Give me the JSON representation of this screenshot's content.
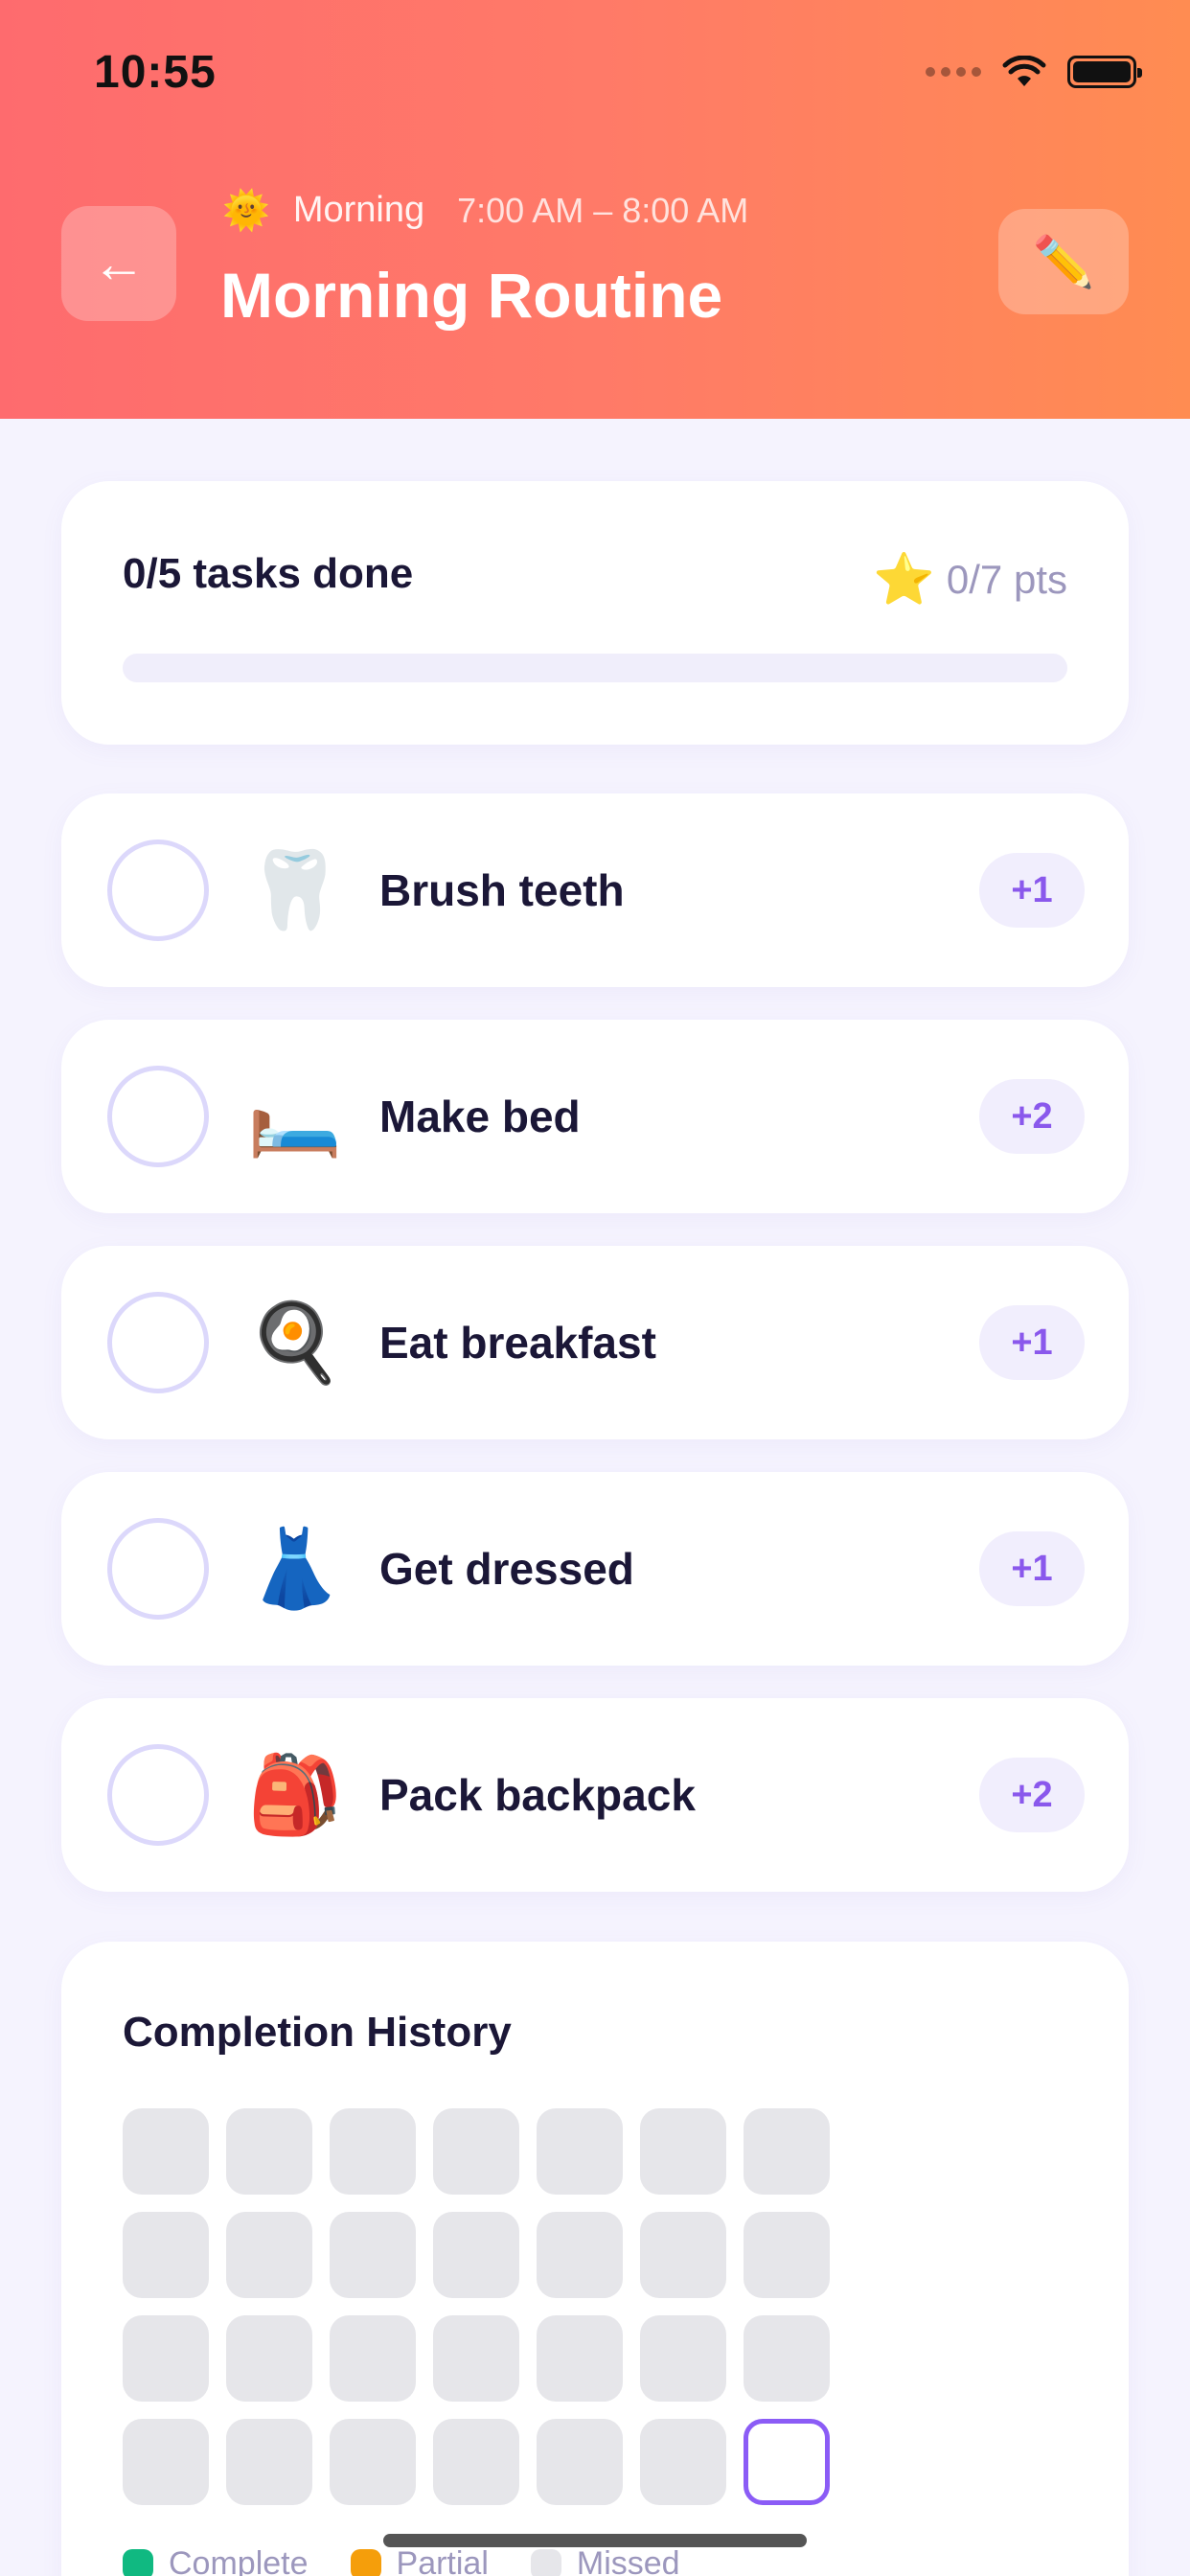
{
  "status_bar": {
    "time": "10:55"
  },
  "header": {
    "back_icon": "arrow-left-icon",
    "back_glyph": "←",
    "period_icon": "🌞",
    "period": "Morning",
    "time_range": "7:00 AM – 8:00 AM",
    "title": "Morning Routine",
    "edit_icon": "✏️"
  },
  "summary": {
    "tasks_done": "0/5 tasks done",
    "points_icon": "⭐",
    "points": "0/7 pts",
    "progress_fraction": 0,
    "progress_color": "#8b5cf6"
  },
  "tasks": [
    {
      "emoji": "🦷",
      "label": "Brush teeth",
      "points": "+1",
      "done": false
    },
    {
      "emoji": "🛏️",
      "label": "Make bed",
      "points": "+2",
      "done": false
    },
    {
      "emoji": "🍳",
      "label": "Eat breakfast",
      "points": "+1",
      "done": false
    },
    {
      "emoji": "👗",
      "label": "Get dressed",
      "points": "+1",
      "done": false
    },
    {
      "emoji": "🎒",
      "label": "Pack backpack",
      "points": "+2",
      "done": false
    }
  ],
  "history": {
    "title": "Completion History",
    "days": [
      "missed",
      "missed",
      "missed",
      "missed",
      "missed",
      "missed",
      "missed",
      "missed",
      "missed",
      "missed",
      "missed",
      "missed",
      "missed",
      "missed",
      "missed",
      "missed",
      "missed",
      "missed",
      "missed",
      "missed",
      "missed",
      "missed",
      "missed",
      "missed",
      "missed",
      "missed",
      "missed",
      "today"
    ],
    "legend": [
      {
        "label": "Complete",
        "color": "#10b981"
      },
      {
        "label": "Partial",
        "color": "#f59e0b"
      },
      {
        "label": "Missed",
        "color": "#e6e6ea"
      }
    ]
  },
  "colors": {
    "accent": "#8b5cf6",
    "header_gradient_start": "#fe6b6e",
    "header_gradient_end": "#ff8c52"
  }
}
